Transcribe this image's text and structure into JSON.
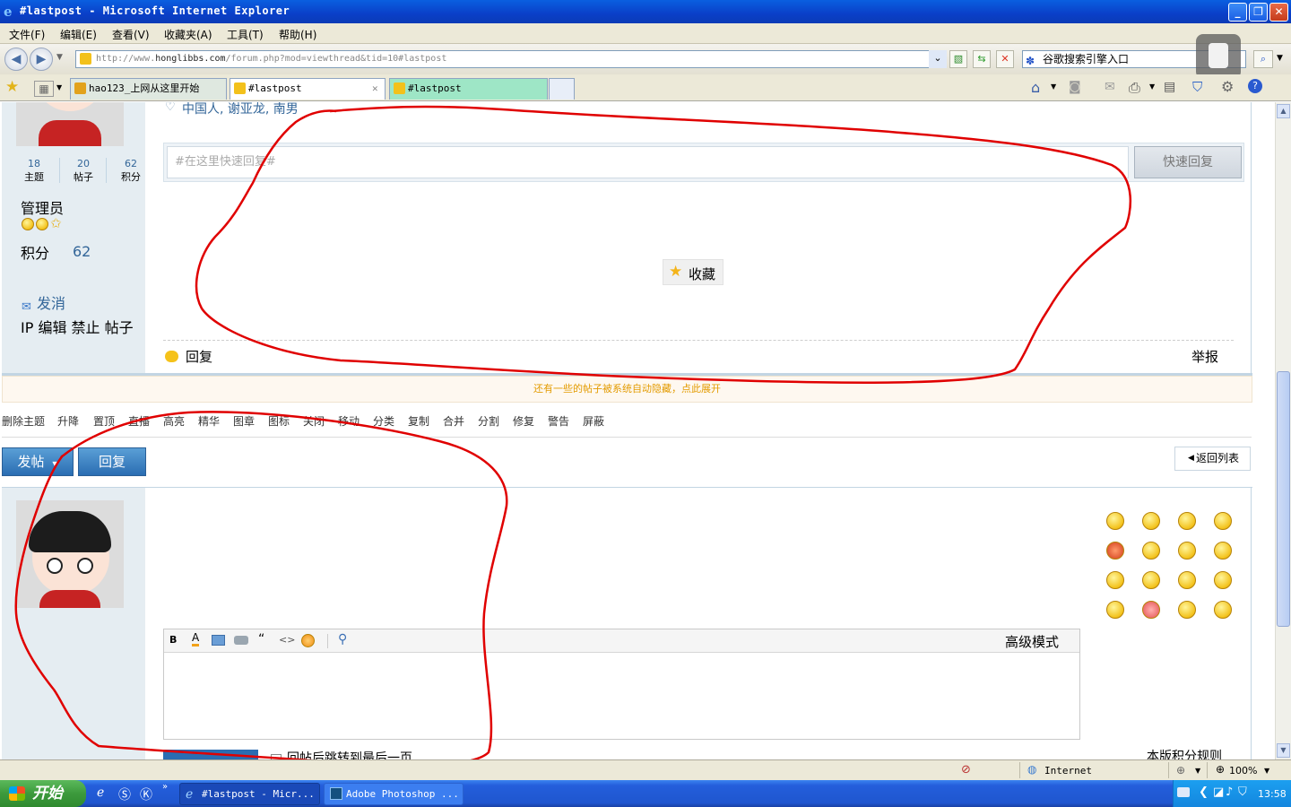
{
  "window": {
    "title": "#lastpost - Microsoft Internet Explorer"
  },
  "menu": [
    "文件(F)",
    "编辑(E)",
    "查看(V)",
    "收藏夹(A)",
    "工具(T)",
    "帮助(H)"
  ],
  "address": {
    "prefix": "http://www.",
    "host": "honglibbs.com",
    "path": "/forum.php?mod=viewthread&tid=10#lastpost"
  },
  "search": {
    "value": "谷歌搜索引擎入口"
  },
  "tabs": [
    {
      "label": "hao123_上网从这里开始",
      "active": false
    },
    {
      "label": "#lastpost",
      "active": true
    },
    {
      "label": "#lastpost",
      "active": false
    }
  ],
  "post1": {
    "tags": "中国人, 谢亚龙, 南男",
    "stats": [
      {
        "value": "18",
        "label": "主题"
      },
      {
        "value": "20",
        "label": "帖子"
      },
      {
        "value": "62",
        "label": "积分"
      }
    ],
    "role": "管理员",
    "points_label": "积分",
    "points_value": "62",
    "send_message": "发消",
    "admin_actions": "IP 编辑 禁止 帖子",
    "quick_reply_placeholder": "#在这里快速回复#",
    "quick_reply_button": "快速回复",
    "favorite_button": "收藏",
    "reply_link": "回复",
    "report_link": "举报"
  },
  "hidden_notice": "还有一些的帖子被系统自动隐藏，点此展开",
  "mod_actions": [
    "删除主题",
    "升降",
    "置顶",
    "直播",
    "高亮",
    "精华",
    "图章",
    "图标",
    "关闭",
    "移动",
    "分类",
    "复制",
    "合并",
    "分割",
    "修复",
    "警告",
    "屏蔽"
  ],
  "buttons": {
    "new_post": "发帖",
    "reply": "回复",
    "back_to_list": "返回列表"
  },
  "editor": {
    "toolbar": [
      "B",
      "A",
      "image",
      "link",
      "“",
      "<>",
      "smiley",
      "attach"
    ],
    "advanced_mode": "高级模式",
    "jump_after_reply": "回帖后跳转到最后一页",
    "rules_link": "本版积分规则"
  },
  "status": {
    "zone": "Internet",
    "zoom": "100%"
  },
  "taskbar": {
    "start": "开始",
    "items": [
      "#lastpost - Micr...",
      "Adobe Photoshop ..."
    ],
    "clock": "13:58"
  },
  "colors": {
    "annotation_red": "#e00000",
    "forum_blue": "#336699",
    "xp_blue": "#245edb"
  }
}
